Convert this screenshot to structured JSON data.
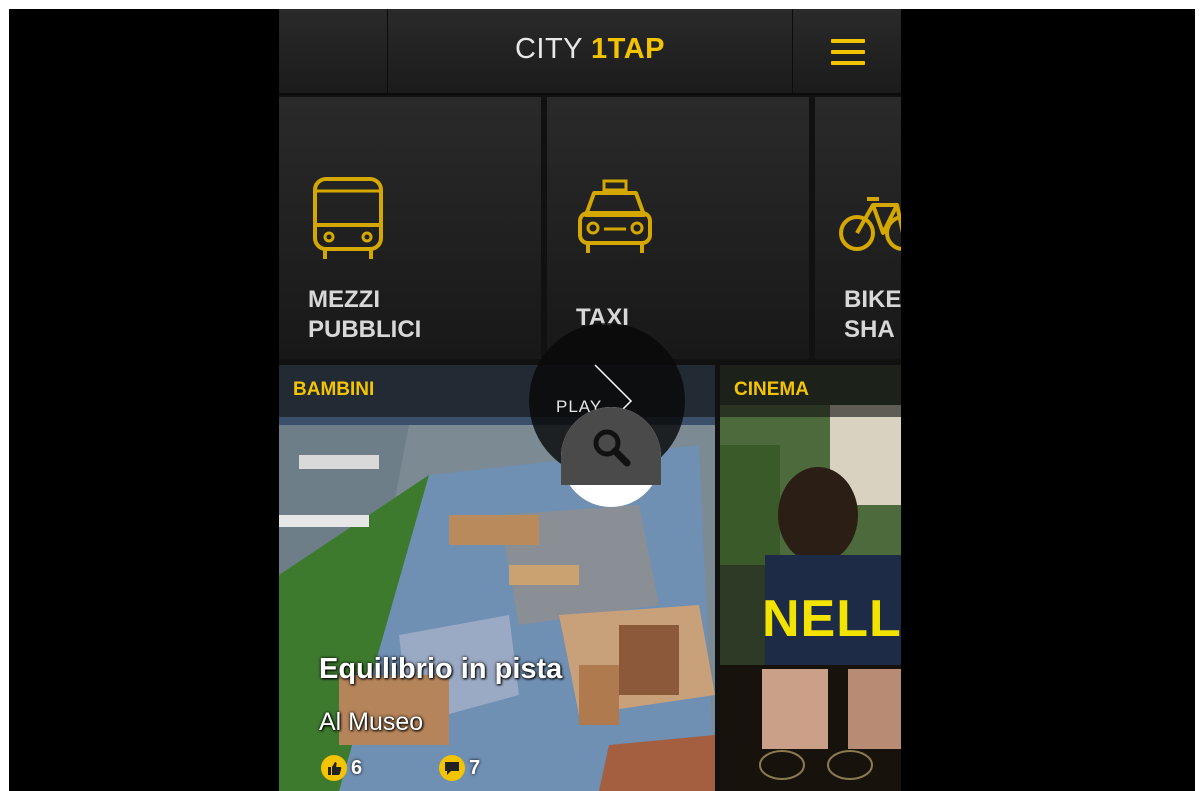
{
  "header": {
    "brand_prefix": "CITY",
    "brand_accent": "1TAP",
    "menu_icon": "hamburger-menu-icon"
  },
  "categories": [
    {
      "label": "MEZZI\nPUBBLICI",
      "icon": "bus-icon"
    },
    {
      "label": "TAXI",
      "icon": "taxi-icon"
    },
    {
      "label": "BIKE\nSHA",
      "icon": "bicycle-icon"
    }
  ],
  "feed": [
    {
      "category": "BAMBINI",
      "title": "Equilibrio in pista",
      "subtitle": "Al Museo",
      "likes": "6",
      "comments": "7"
    },
    {
      "category": "CINEMA",
      "poster_text": "NELL"
    }
  ],
  "overlay": {
    "play_label": "PLAY",
    "search_icon": "search-icon"
  },
  "colors": {
    "accent": "#f5c400",
    "background": "#000000",
    "tile": "#222222"
  }
}
